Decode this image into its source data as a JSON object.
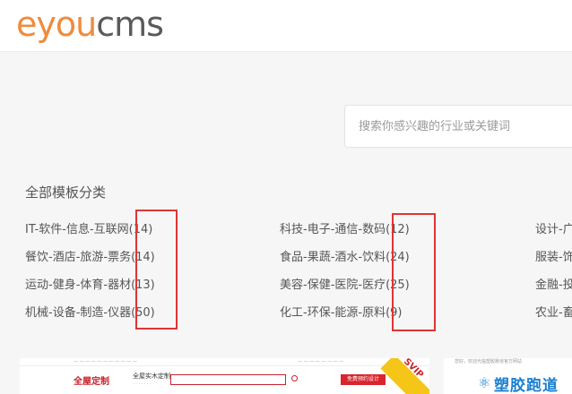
{
  "header": {
    "logo_part1": "eyou",
    "logo_part2": "cms"
  },
  "search": {
    "placeholder": "搜索你感兴趣的行业或关键词"
  },
  "section": {
    "title": "全部模板分类"
  },
  "categories": {
    "col1": [
      "IT-软件-信息-互联网(14)",
      "餐饮-酒店-旅游-票务(14)",
      "运动-健身-体育-器材(13)",
      "机械-设备-制造-仪器(50)"
    ],
    "col2": [
      "科技-电子-通信-数码(12)",
      "食品-果蔬-酒水-饮料(24)",
      "美容-保健-医院-医疗(25)",
      "化工-环保-能源-原料(9)"
    ],
    "col3": [
      "设计-广",
      "服装-饰",
      "金融-投",
      "农业-畜"
    ]
  },
  "cards": {
    "card1": {
      "brand": "全屋定制",
      "slogan": "全屋实木定制",
      "slogan_sub": "· · · · · · ·",
      "cta": "免费预约设计",
      "badge": "SVIP"
    },
    "card2": {
      "top_text": "您好，欢迎光临塑胶跑道官方网站",
      "logo_text": "塑胶跑道"
    }
  },
  "colors": {
    "logo_orange": "#f08b3c",
    "logo_gray": "#5a5a5a",
    "highlight_red": "#e03434"
  }
}
